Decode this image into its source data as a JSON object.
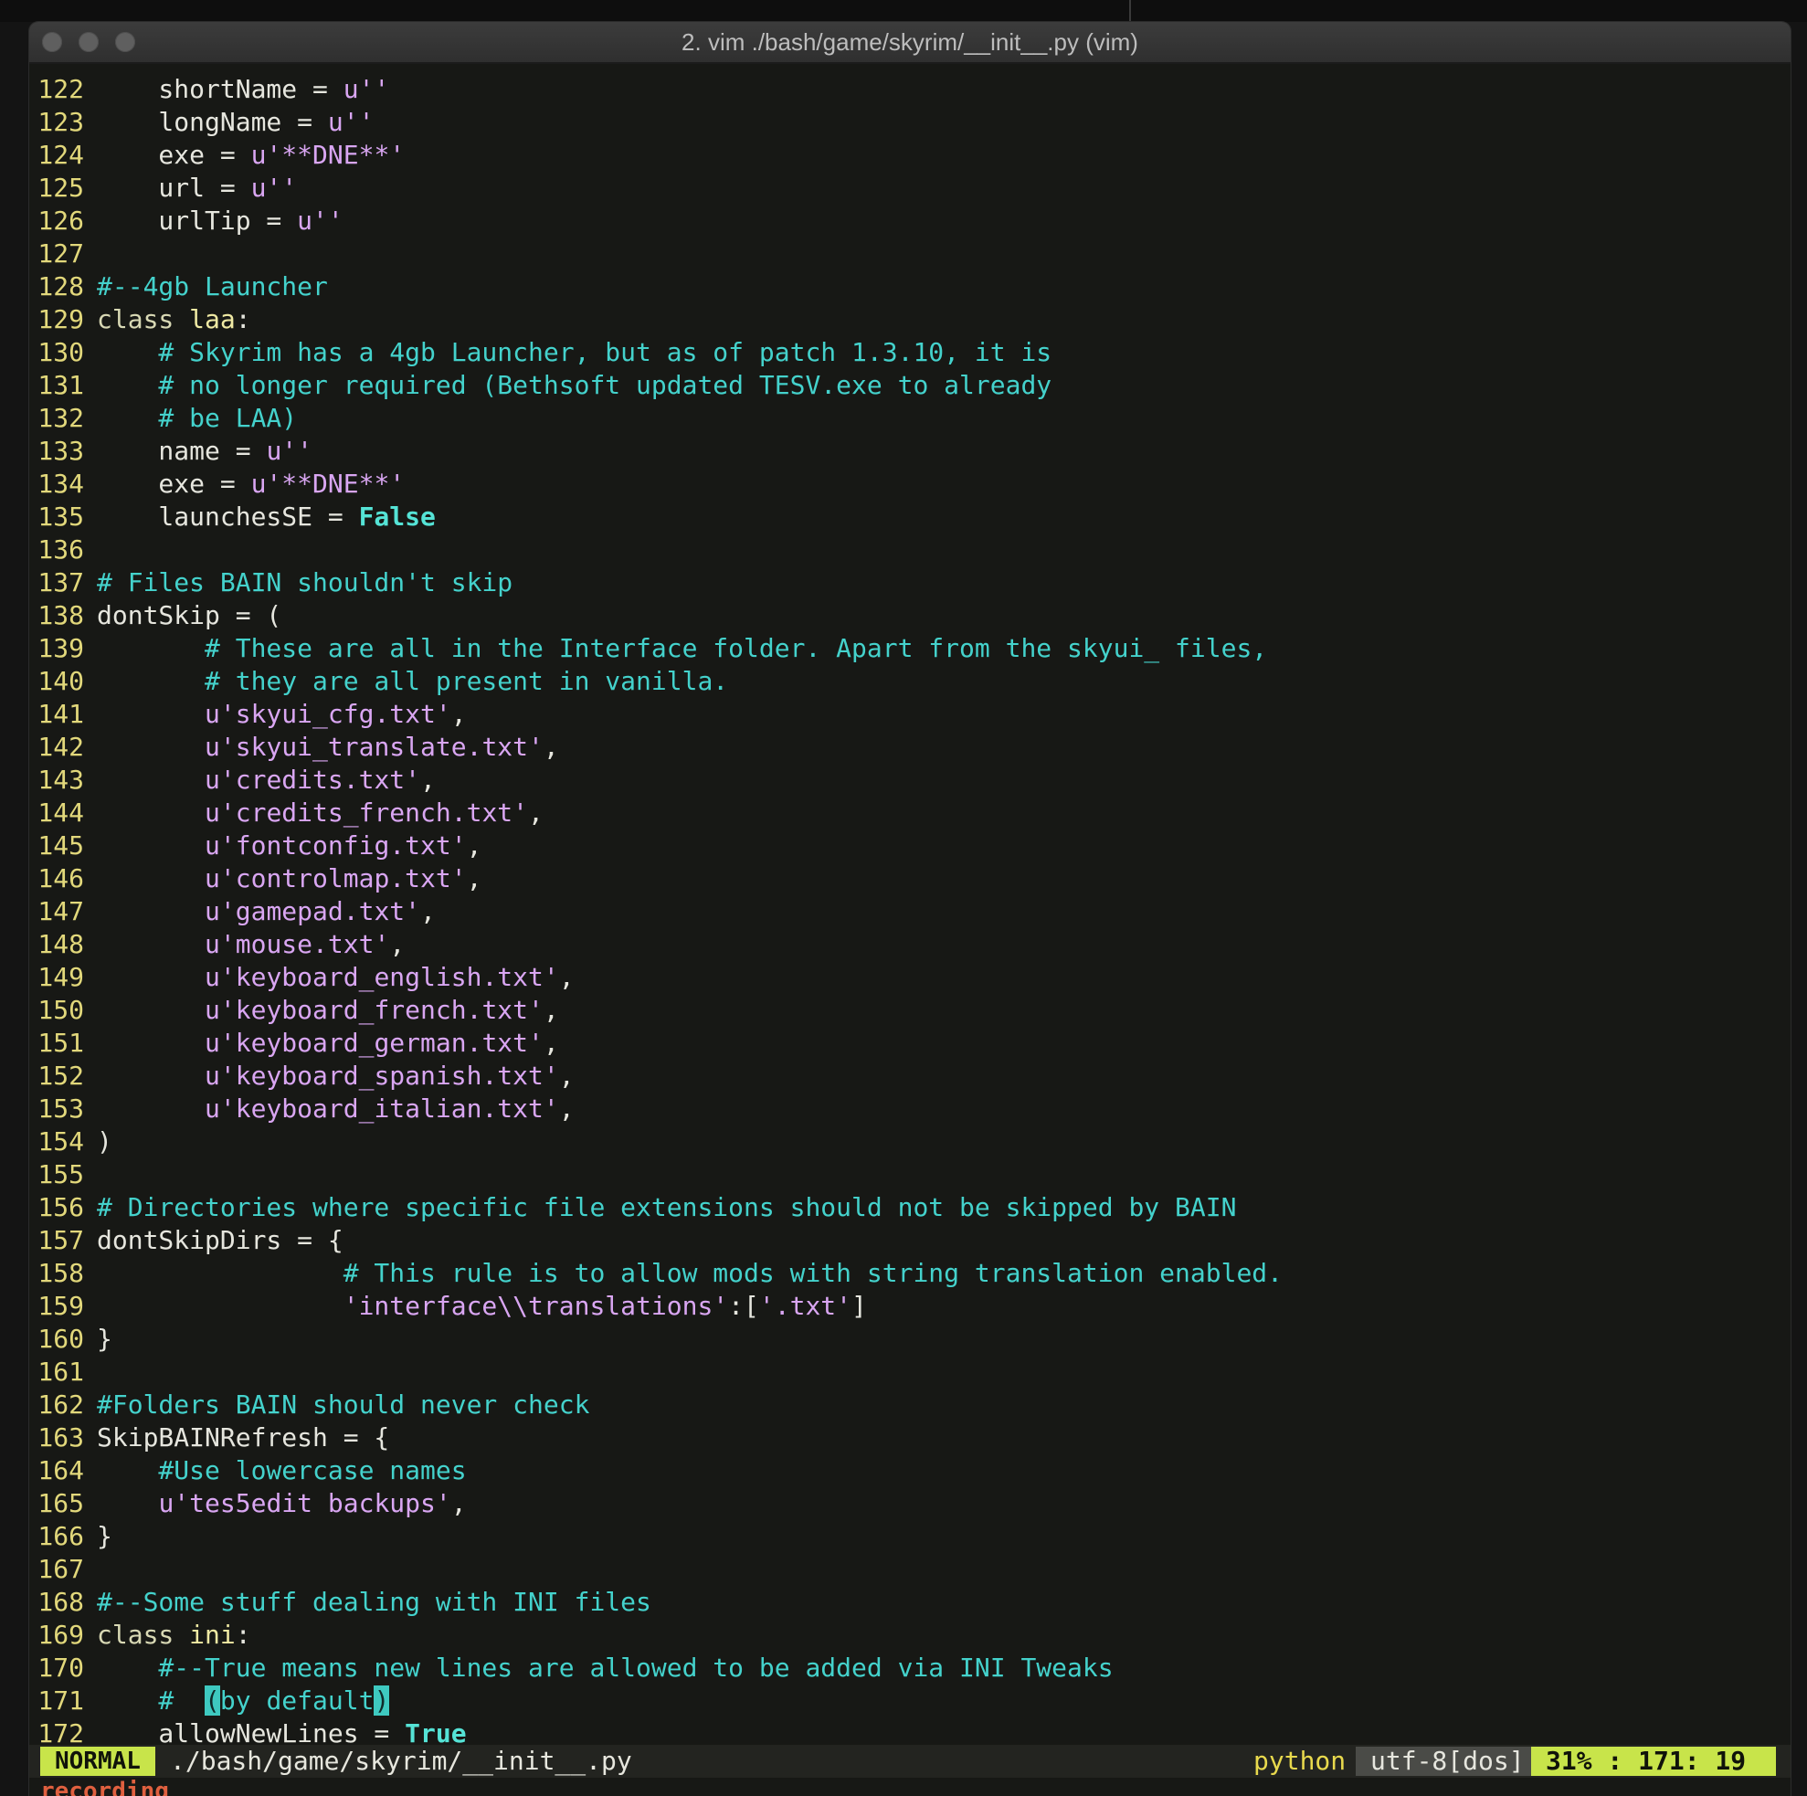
{
  "window": {
    "title": "2. vim ./bash/game/skyrim/__init__.py (vim)",
    "traffic_lights": [
      "close-button",
      "minimize-button",
      "zoom-button"
    ]
  },
  "editor": {
    "lines": [
      {
        "n": "122",
        "segs": [
          {
            "t": "    shortName = ",
            "c": ""
          },
          {
            "t": "u''",
            "c": "st"
          }
        ]
      },
      {
        "n": "123",
        "segs": [
          {
            "t": "    longName = ",
            "c": ""
          },
          {
            "t": "u''",
            "c": "st"
          }
        ]
      },
      {
        "n": "124",
        "segs": [
          {
            "t": "    exe = ",
            "c": ""
          },
          {
            "t": "u'**DNE**'",
            "c": "st"
          }
        ]
      },
      {
        "n": "125",
        "segs": [
          {
            "t": "    url = ",
            "c": ""
          },
          {
            "t": "u''",
            "c": "st"
          }
        ]
      },
      {
        "n": "126",
        "segs": [
          {
            "t": "    urlTip = ",
            "c": ""
          },
          {
            "t": "u''",
            "c": "st"
          }
        ]
      },
      {
        "n": "127",
        "segs": []
      },
      {
        "n": "128",
        "segs": [
          {
            "t": "#--4gb Launcher",
            "c": "cm"
          }
        ]
      },
      {
        "n": "129",
        "segs": [
          {
            "t": "class ",
            "c": "kw"
          },
          {
            "t": "laa",
            "c": "cls"
          },
          {
            "t": ":",
            "c": ""
          }
        ]
      },
      {
        "n": "130",
        "segs": [
          {
            "t": "    # Skyrim has a 4gb Launcher, but as of patch 1.3.10, it is",
            "c": "cm"
          }
        ]
      },
      {
        "n": "131",
        "segs": [
          {
            "t": "    # no longer required (Bethsoft updated TESV.exe to already",
            "c": "cm"
          }
        ]
      },
      {
        "n": "132",
        "segs": [
          {
            "t": "    # be LAA)",
            "c": "cm"
          }
        ]
      },
      {
        "n": "133",
        "segs": [
          {
            "t": "    name = ",
            "c": ""
          },
          {
            "t": "u''",
            "c": "st"
          }
        ]
      },
      {
        "n": "134",
        "segs": [
          {
            "t": "    exe = ",
            "c": ""
          },
          {
            "t": "u'**DNE**'",
            "c": "st"
          }
        ]
      },
      {
        "n": "135",
        "segs": [
          {
            "t": "    launchesSE = ",
            "c": ""
          },
          {
            "t": "False",
            "c": "bi"
          }
        ]
      },
      {
        "n": "136",
        "segs": []
      },
      {
        "n": "137",
        "segs": [
          {
            "t": "# Files BAIN shouldn't skip",
            "c": "cm"
          }
        ]
      },
      {
        "n": "138",
        "segs": [
          {
            "t": "dontSkip = (",
            "c": ""
          }
        ]
      },
      {
        "n": "139",
        "segs": [
          {
            "t": "       # These are all in the Interface folder. Apart from the skyui_ files,",
            "c": "cm"
          }
        ]
      },
      {
        "n": "140",
        "segs": [
          {
            "t": "       # they are all present in vanilla.",
            "c": "cm"
          }
        ]
      },
      {
        "n": "141",
        "segs": [
          {
            "t": "       ",
            "c": ""
          },
          {
            "t": "u'skyui_cfg.txt'",
            "c": "st"
          },
          {
            "t": ",",
            "c": ""
          }
        ]
      },
      {
        "n": "142",
        "segs": [
          {
            "t": "       ",
            "c": ""
          },
          {
            "t": "u'skyui_translate.txt'",
            "c": "st"
          },
          {
            "t": ",",
            "c": ""
          }
        ]
      },
      {
        "n": "143",
        "segs": [
          {
            "t": "       ",
            "c": ""
          },
          {
            "t": "u'credits.txt'",
            "c": "st"
          },
          {
            "t": ",",
            "c": ""
          }
        ]
      },
      {
        "n": "144",
        "segs": [
          {
            "t": "       ",
            "c": ""
          },
          {
            "t": "u'credits_french.txt'",
            "c": "st"
          },
          {
            "t": ",",
            "c": ""
          }
        ]
      },
      {
        "n": "145",
        "segs": [
          {
            "t": "       ",
            "c": ""
          },
          {
            "t": "u'fontconfig.txt'",
            "c": "st"
          },
          {
            "t": ",",
            "c": ""
          }
        ]
      },
      {
        "n": "146",
        "segs": [
          {
            "t": "       ",
            "c": ""
          },
          {
            "t": "u'controlmap.txt'",
            "c": "st"
          },
          {
            "t": ",",
            "c": ""
          }
        ]
      },
      {
        "n": "147",
        "segs": [
          {
            "t": "       ",
            "c": ""
          },
          {
            "t": "u'gamepad.txt'",
            "c": "st"
          },
          {
            "t": ",",
            "c": ""
          }
        ]
      },
      {
        "n": "148",
        "segs": [
          {
            "t": "       ",
            "c": ""
          },
          {
            "t": "u'mouse.txt'",
            "c": "st"
          },
          {
            "t": ",",
            "c": ""
          }
        ]
      },
      {
        "n": "149",
        "segs": [
          {
            "t": "       ",
            "c": ""
          },
          {
            "t": "u'keyboard_english.txt'",
            "c": "st"
          },
          {
            "t": ",",
            "c": ""
          }
        ]
      },
      {
        "n": "150",
        "segs": [
          {
            "t": "       ",
            "c": ""
          },
          {
            "t": "u'keyboard_french.txt'",
            "c": "st"
          },
          {
            "t": ",",
            "c": ""
          }
        ]
      },
      {
        "n": "151",
        "segs": [
          {
            "t": "       ",
            "c": ""
          },
          {
            "t": "u'keyboard_german.txt'",
            "c": "st"
          },
          {
            "t": ",",
            "c": ""
          }
        ]
      },
      {
        "n": "152",
        "segs": [
          {
            "t": "       ",
            "c": ""
          },
          {
            "t": "u'keyboard_spanish.txt'",
            "c": "st"
          },
          {
            "t": ",",
            "c": ""
          }
        ]
      },
      {
        "n": "153",
        "segs": [
          {
            "t": "       ",
            "c": ""
          },
          {
            "t": "u'keyboard_italian.txt'",
            "c": "st"
          },
          {
            "t": ",",
            "c": ""
          }
        ]
      },
      {
        "n": "154",
        "segs": [
          {
            "t": ")",
            "c": ""
          }
        ]
      },
      {
        "n": "155",
        "segs": []
      },
      {
        "n": "156",
        "segs": [
          {
            "t": "# Directories where specific file extensions should not be skipped by BAIN",
            "c": "cm"
          }
        ]
      },
      {
        "n": "157",
        "segs": [
          {
            "t": "dontSkipDirs = {",
            "c": ""
          }
        ]
      },
      {
        "n": "158",
        "segs": [
          {
            "t": "                ",
            "c": ""
          },
          {
            "t": "# This rule is to allow mods with string translation enabled.",
            "c": "cm"
          }
        ]
      },
      {
        "n": "159",
        "segs": [
          {
            "t": "                ",
            "c": ""
          },
          {
            "t": "'interface\\\\translations'",
            "c": "st"
          },
          {
            "t": ":[",
            "c": ""
          },
          {
            "t": "'.txt'",
            "c": "st"
          },
          {
            "t": "]",
            "c": ""
          }
        ]
      },
      {
        "n": "160",
        "segs": [
          {
            "t": "}",
            "c": ""
          }
        ]
      },
      {
        "n": "161",
        "segs": []
      },
      {
        "n": "162",
        "segs": [
          {
            "t": "#Folders BAIN should never check",
            "c": "cm"
          }
        ]
      },
      {
        "n": "163",
        "segs": [
          {
            "t": "SkipBAINRefresh = {",
            "c": ""
          }
        ]
      },
      {
        "n": "164",
        "segs": [
          {
            "t": "    #Use lowercase names",
            "c": "cm"
          }
        ]
      },
      {
        "n": "165",
        "segs": [
          {
            "t": "    ",
            "c": ""
          },
          {
            "t": "u'tes5edit backups'",
            "c": "st"
          },
          {
            "t": ",",
            "c": ""
          }
        ]
      },
      {
        "n": "166",
        "segs": [
          {
            "t": "}",
            "c": ""
          }
        ]
      },
      {
        "n": "167",
        "segs": []
      },
      {
        "n": "168",
        "segs": [
          {
            "t": "#--Some stuff dealing with INI files",
            "c": "cm"
          }
        ]
      },
      {
        "n": "169",
        "segs": [
          {
            "t": "class ",
            "c": "kw"
          },
          {
            "t": "ini",
            "c": "cls"
          },
          {
            "t": ":",
            "c": ""
          }
        ]
      },
      {
        "n": "170",
        "segs": [
          {
            "t": "    #--True means new lines are allowed to be added via INI Tweaks",
            "c": "cm"
          }
        ]
      },
      {
        "n": "171",
        "segs": [
          {
            "t": "    #  ",
            "c": "cm"
          },
          {
            "t": "(",
            "c": "cursor-hl"
          },
          {
            "t": "by default",
            "c": "cm"
          },
          {
            "t": ")",
            "c": "cursor-hl"
          }
        ]
      },
      {
        "n": "172",
        "segs": [
          {
            "t": "    allowNewLines = ",
            "c": ""
          },
          {
            "t": "True",
            "c": "bi"
          }
        ]
      }
    ]
  },
  "statusline": {
    "mode": "NORMAL",
    "path": "./bash/game/skyrim/__init__.py",
    "filetype": "python",
    "encoding": "utf-8[dos]",
    "position": "31% : 171: 19"
  },
  "cmdline": {
    "text": "recording"
  },
  "colors": {
    "background": "#171815",
    "line_number": "#e2d87b",
    "comment": "#44d2cc",
    "string": "#d9a6f2",
    "mode_accent": "#c8e44a",
    "recording": "#e0603f"
  }
}
